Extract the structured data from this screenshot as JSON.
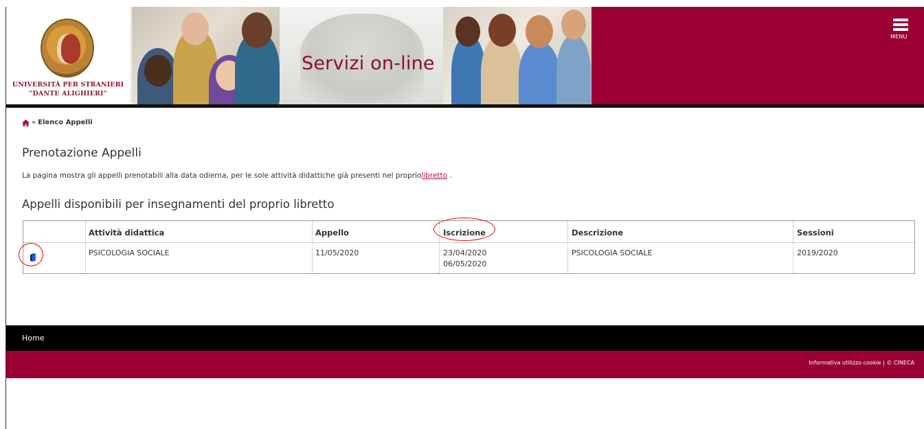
{
  "header": {
    "logo_line1": "UNIVERSITÀ PER STRANIERI",
    "logo_line2": "\"DANTE ALIGHIERI\"",
    "site_title": "Servizi on-line",
    "menu_label": "MENU",
    "brand_color": "#9b0036"
  },
  "breadcrumb": {
    "home_icon": "home-icon",
    "separator": "»",
    "current": "Elenco Appelli"
  },
  "page": {
    "title": "Prenotazione Appelli",
    "intro_text": "La pagina mostra gli appelli prenotabili alla data odierna, per le sole attività didattiche già presenti nel proprio",
    "intro_link": "libretto",
    "intro_end": " .",
    "section_title": "Appelli disponibili per insegnamenti del proprio libretto"
  },
  "table": {
    "columns": [
      "",
      "Attività didattica",
      "Appello",
      "Iscrizione",
      "Descrizione",
      "Sessioni"
    ],
    "rows": [
      {
        "icon": "book-icon",
        "attivita": "PSICOLOGIA SOCIALE",
        "appello": "11/05/2020",
        "iscrizione_start": "23/04/2020",
        "iscrizione_end": "06/05/2020",
        "descrizione": "PSICOLOGIA SOCIALE",
        "sessioni": "2019/2020"
      }
    ]
  },
  "footer": {
    "home_label": "Home",
    "cookie_link": "Informativa utilizzo cookie",
    "divider": "|",
    "copyright": "© CINECA"
  }
}
